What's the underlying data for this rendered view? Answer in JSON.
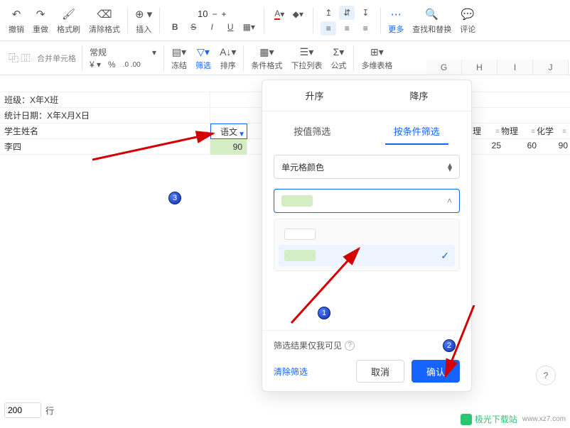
{
  "toolbar1": {
    "undo": "撤销",
    "redo": "重做",
    "format_painter": "格式刷",
    "clear_format": "清除格式",
    "insert": "插入",
    "font_size": "10",
    "more": "更多",
    "find_replace": "查找和替换",
    "comment": "评论"
  },
  "toolbar2": {
    "merge": "合并单元格",
    "normal": "常规",
    "freeze": "冻结",
    "filter": "筛选",
    "sort": "排序",
    "cond_format": "条件格式",
    "dropdown": "下拉列表",
    "formula": "公式",
    "multi_table": "多维表格",
    "pct": "%",
    "decimal_sample": ".0  .00"
  },
  "sheet": {
    "r1": "班级：X年X班",
    "r2": "统计日期：X年X月X日",
    "name_header": "学生姓名",
    "lang_header": "语文",
    "row1_name": "李四",
    "row1_lang": "90",
    "cols": [
      "G",
      "H",
      "I",
      "J"
    ],
    "col_li": "理",
    "col_wuli": "物理",
    "col_hua": "化学",
    "v_li": "25",
    "v_wuli": "60",
    "v_hua": "90"
  },
  "panel": {
    "asc": "升序",
    "desc": "降序",
    "by_value": "按值筛选",
    "by_cond": "按条件筛选",
    "cell_color": "单元格颜色",
    "only_me": "筛选结果仅我可见",
    "clear": "清除筛选",
    "cancel": "取消",
    "confirm": "确认"
  },
  "footer": {
    "count": "200",
    "rows": "行"
  },
  "watermark": {
    "name": "极光下载站",
    "domain": "www.xz7.com"
  }
}
